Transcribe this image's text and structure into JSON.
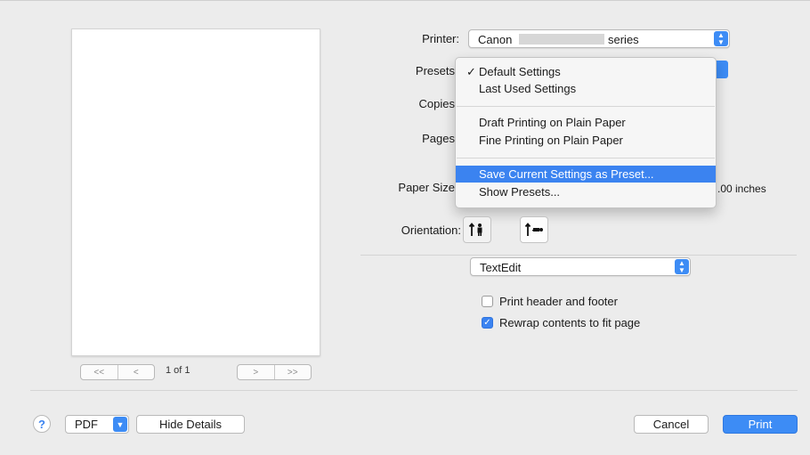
{
  "preview": {
    "nav_first": "<<",
    "nav_prev": "<",
    "page_count": "1 of 1",
    "nav_next": ">",
    "nav_last": ">>"
  },
  "printer": {
    "label": "Printer:",
    "brand": "Canon",
    "suffix": "series"
  },
  "presets": {
    "label": "Presets"
  },
  "copies": {
    "label": "Copies"
  },
  "pages": {
    "label": "Pages"
  },
  "paper_size": {
    "label": "Paper Size",
    "value_tail": ".00 inches"
  },
  "menu": {
    "checked_mark": "✓",
    "items": [
      "Default Settings",
      "Last Used Settings",
      "Draft Printing on Plain Paper",
      "Fine Printing on Plain Paper",
      "Save Current Settings as Preset...",
      "Show Presets..."
    ]
  },
  "orientation": {
    "label": "Orientation:"
  },
  "app_popup": {
    "value": "TextEdit"
  },
  "options": {
    "header_footer": {
      "label": "Print header and footer",
      "checked": false
    },
    "rewrap": {
      "label": "Rewrap contents to fit page",
      "checked": true
    }
  },
  "footer": {
    "help": "?",
    "pdf": "PDF",
    "hide_details": "Hide Details",
    "cancel": "Cancel",
    "print": "Print"
  },
  "icons": [
    "stepper-icon",
    "checkmark-icon",
    "portrait-orientation-icon",
    "landscape-orientation-icon",
    "pdf-chevron-icon"
  ],
  "colors": {
    "accent": "#3b83f0",
    "background": "#ececec"
  }
}
